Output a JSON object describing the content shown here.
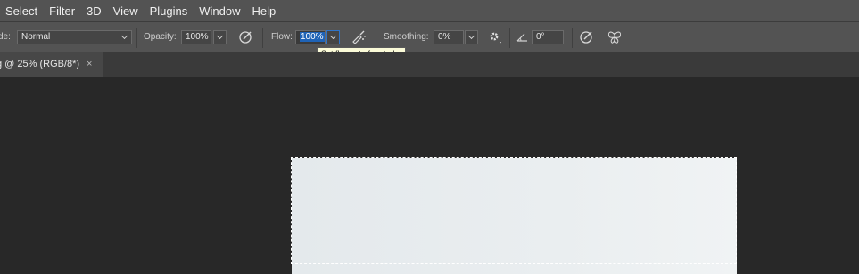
{
  "menubar": {
    "items": [
      "Select",
      "Filter",
      "3D",
      "View",
      "Plugins",
      "Window",
      "Help"
    ]
  },
  "options": {
    "mode_label": "de:",
    "mode_value": "Normal",
    "opacity_label": "Opacity:",
    "opacity_value": "100%",
    "flow_label": "Flow:",
    "flow_value": "100%",
    "smoothing_label": "Smoothing:",
    "smoothing_value": "0%",
    "angle_value": "0°"
  },
  "tooltip": {
    "text": "Set flow rate for stroke"
  },
  "document_tab": {
    "title": "g @ 25% (RGB/8*)",
    "close": "×"
  },
  "colors": {
    "highlight": "#1f63b6",
    "panel": "#535353",
    "workspace": "#282828"
  }
}
